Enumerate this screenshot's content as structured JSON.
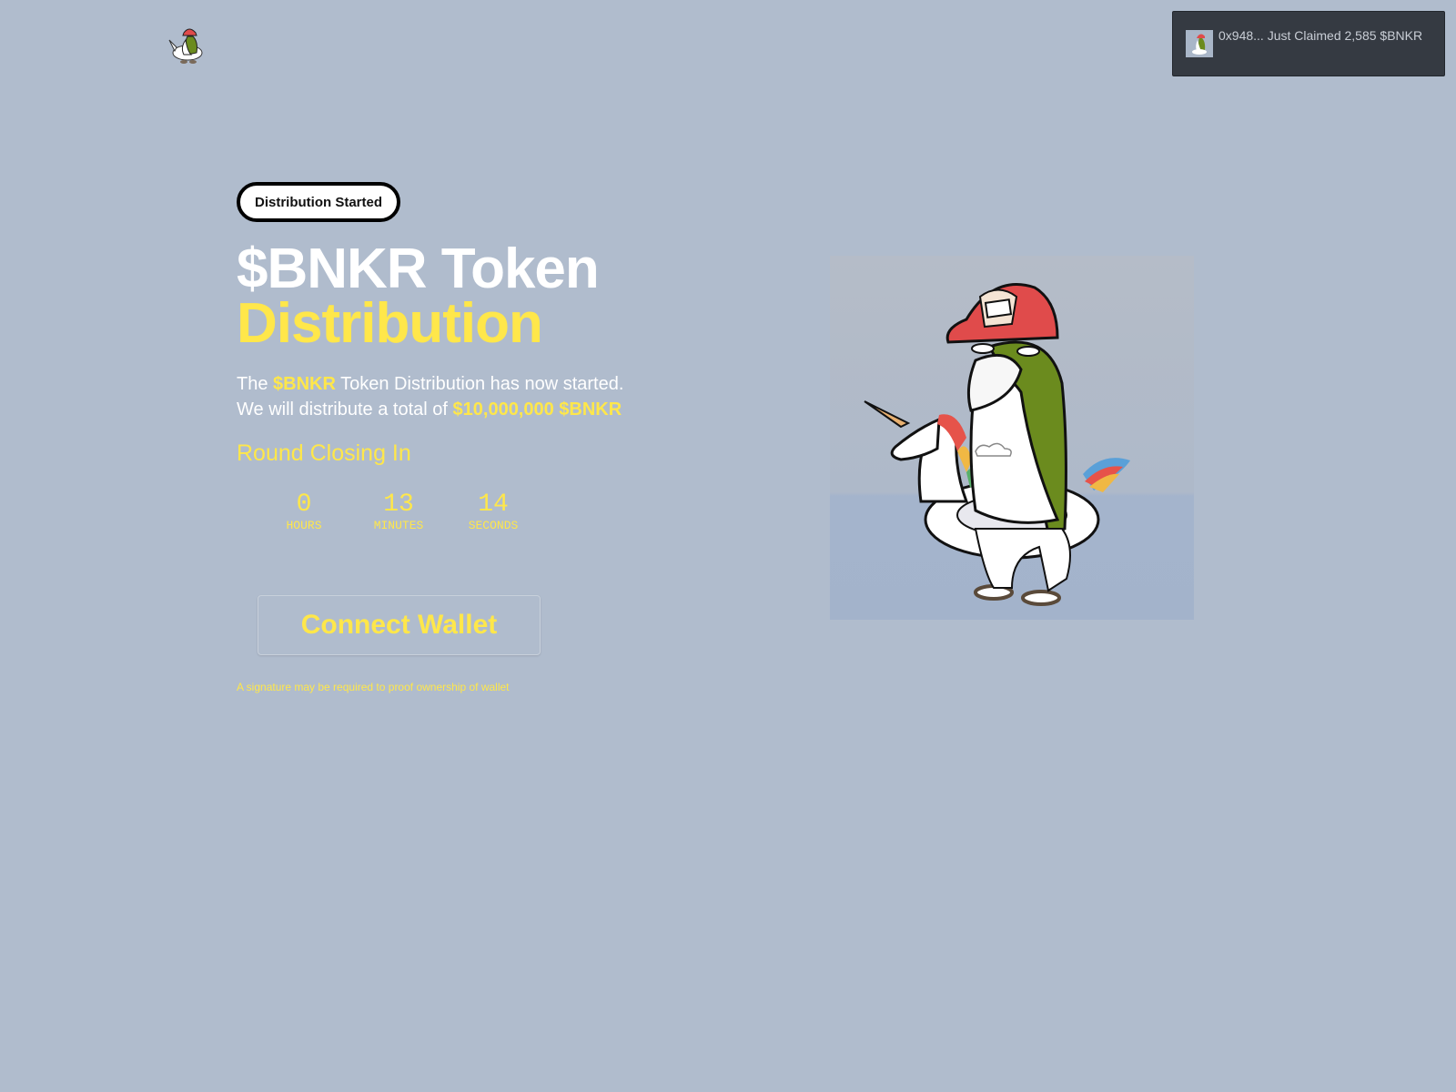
{
  "header": {
    "logo_icon": "penguin-unicorn-logo"
  },
  "toast": {
    "avatar_icon": "penguin-avatar",
    "message": "0x948... Just Claimed 2,585 $BNKR"
  },
  "hero": {
    "badge": "Distribution Started",
    "title_line1": "$BNKR Token",
    "title_line2": "Distribution",
    "desc_line1_pre": "The ",
    "desc_line1_hl": "$BNKR",
    "desc_line1_post": " Token Distribution has now started.",
    "desc_line2_pre": "We will distribute a total of ",
    "desc_line2_hl": "$10,000,000 $BNKR",
    "round_label": "Round Closing In",
    "countdown": {
      "hours": "0",
      "hours_label": "HOURS",
      "minutes": "13",
      "minutes_label": "MINUTES",
      "seconds": "14",
      "seconds_label": "SECONDS"
    },
    "connect_button": "Connect Wallet",
    "signature_note": "A signature may be required to proof ownership of wallet",
    "image_icon": "penguin-on-unicorn-float-illustration"
  },
  "colors": {
    "background": "#b0bccd",
    "accent": "#ffe74a",
    "toast_bg": "#353a42"
  }
}
